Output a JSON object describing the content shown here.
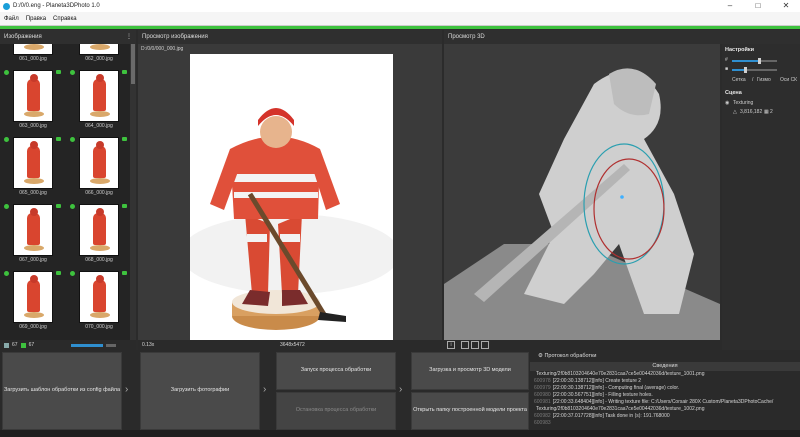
{
  "window": {
    "title": "D:/0/0.eng - Planeta3DPhoto 1.0"
  },
  "menu": [
    "Файл",
    "Правка",
    "Справка"
  ],
  "panels": {
    "images_title": "Изображения",
    "preview_title": "Просмотр изображения",
    "view3d_title": "Просмотр 3D"
  },
  "thumbnails": [
    {
      "label": "061_000.jpg"
    },
    {
      "label": "062_000.jpg"
    },
    {
      "label": "063_000.jpg"
    },
    {
      "label": "064_000.jpg"
    },
    {
      "label": "065_000.jpg"
    },
    {
      "label": "066_000.jpg"
    },
    {
      "label": "067_000.jpg"
    },
    {
      "label": "068_000.jpg"
    },
    {
      "label": "069_000.jpg"
    },
    {
      "label": "070_000.jpg"
    }
  ],
  "thumbs_footer": {
    "count_a": "67",
    "count_b": "67"
  },
  "preview": {
    "filename": "D:/0/0/000_000.jpg",
    "zoom": "0.13x",
    "resolution": "3648x5472"
  },
  "settings": {
    "title": "Настройки",
    "grid_label": "Сетка",
    "gizmo_label": "Гизмо",
    "axes_label": "Оси СК",
    "scene_title": "Сцена",
    "layer_name": "Texturing",
    "polycount": "3,816,182",
    "texture_count": "2"
  },
  "actions": {
    "load_template": "Загрузить шаблон обработки из config файла",
    "load_photos": "Загрузить фотографии",
    "start_processing": "Запуск процесса обработки",
    "stop_processing": "Остановка процесса обработки",
    "load_preview_3d": "Загрузка и просмотр 3D модели",
    "open_model_folder": "Открыть папку построенной модели проекта",
    "chevron": "›"
  },
  "log": {
    "title": "Протокол обработки",
    "subtitle": "Сведения",
    "lines": [
      {
        "num": "",
        "text": "Texturing/2f0b8103204640e70e2831caa7ce5e00442036d/texture_1001.png"
      },
      {
        "num": "600978",
        "text": "[22:00:30.138712][info] Create texture 2"
      },
      {
        "num": "600979",
        "text": "[22:00:30.138712][info]  - Computing final (average) color."
      },
      {
        "num": "600980",
        "text": "[22:00:30.567751][info]  - Filling texture holes."
      },
      {
        "num": "600981",
        "text": "[22:00:33.648404][info]  - Writing texture file: C:/Users/Corsair 280X Custom/Planeta3DPhotoCache/"
      },
      {
        "num": "",
        "text": "Texturing/2f0b8103204640e70e2831caa7ce5e00442036d/texture_1002.png"
      },
      {
        "num": "600982",
        "text": "[22:00:37.017728][info] Task done in (s): 191.768000"
      },
      {
        "num": "600983",
        "text": ""
      }
    ]
  },
  "colors": {
    "accent_green": "#3ec23e",
    "accent_blue": "#2f8fd0",
    "bg": "#2b2b2b"
  }
}
